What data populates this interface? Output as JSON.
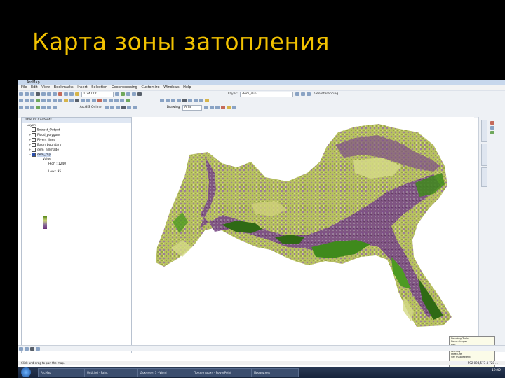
{
  "slide": {
    "title": "Карта зоны затопления"
  },
  "app": {
    "window_title": "ArcMap",
    "menu": [
      "File",
      "Edit",
      "View",
      "Bookmarks",
      "Insert",
      "Selection",
      "Geoprocessing",
      "Customize",
      "Windows",
      "Help"
    ]
  },
  "toolbar": {
    "scale_value": "1:24 000",
    "layer_label": "Layer:",
    "layer_value": "dem_clip",
    "drawing_label": "Drawing",
    "font_value": "Arial",
    "georef_label": "Georeferencing"
  },
  "toc": {
    "header": "Table Of Contents",
    "layers_label": "Layers",
    "items": [
      {
        "label": "Extract_Output",
        "expanded": false
      },
      {
        "label": "Flood_polygons",
        "expanded": false
      },
      {
        "label": "Rivers_lines",
        "expanded": false
      },
      {
        "label": "Basin_boundary",
        "expanded": false
      },
      {
        "label": "dem_hillshade",
        "expanded": false
      },
      {
        "label": "dem_clip",
        "expanded": true
      }
    ],
    "legend_high": "High : 1240",
    "legend_low": "Low : 95",
    "legend_value": "Value"
  },
  "tooltip": {
    "lines": [
      "Drawing Tools",
      "Draw shapes",
      "Pan",
      "Zoom In",
      "Identify",
      "Measure",
      "Set map extent"
    ]
  },
  "status": {
    "left": "Click and drag to pan the map.",
    "coords": "592 094,573  4 728 ..."
  },
  "taskbar": {
    "tasks": [
      "ArcMap",
      "Untitled - Paint",
      "Документ1 - Word",
      "Презентация - PowerPoint",
      "Проводник"
    ],
    "clock": "19:42"
  },
  "colors": {
    "title_yellow": "#f2c200",
    "map_purple": "#6c3a78",
    "map_green": "#2d6a14",
    "map_yellowgreen": "#c5cf6e"
  }
}
